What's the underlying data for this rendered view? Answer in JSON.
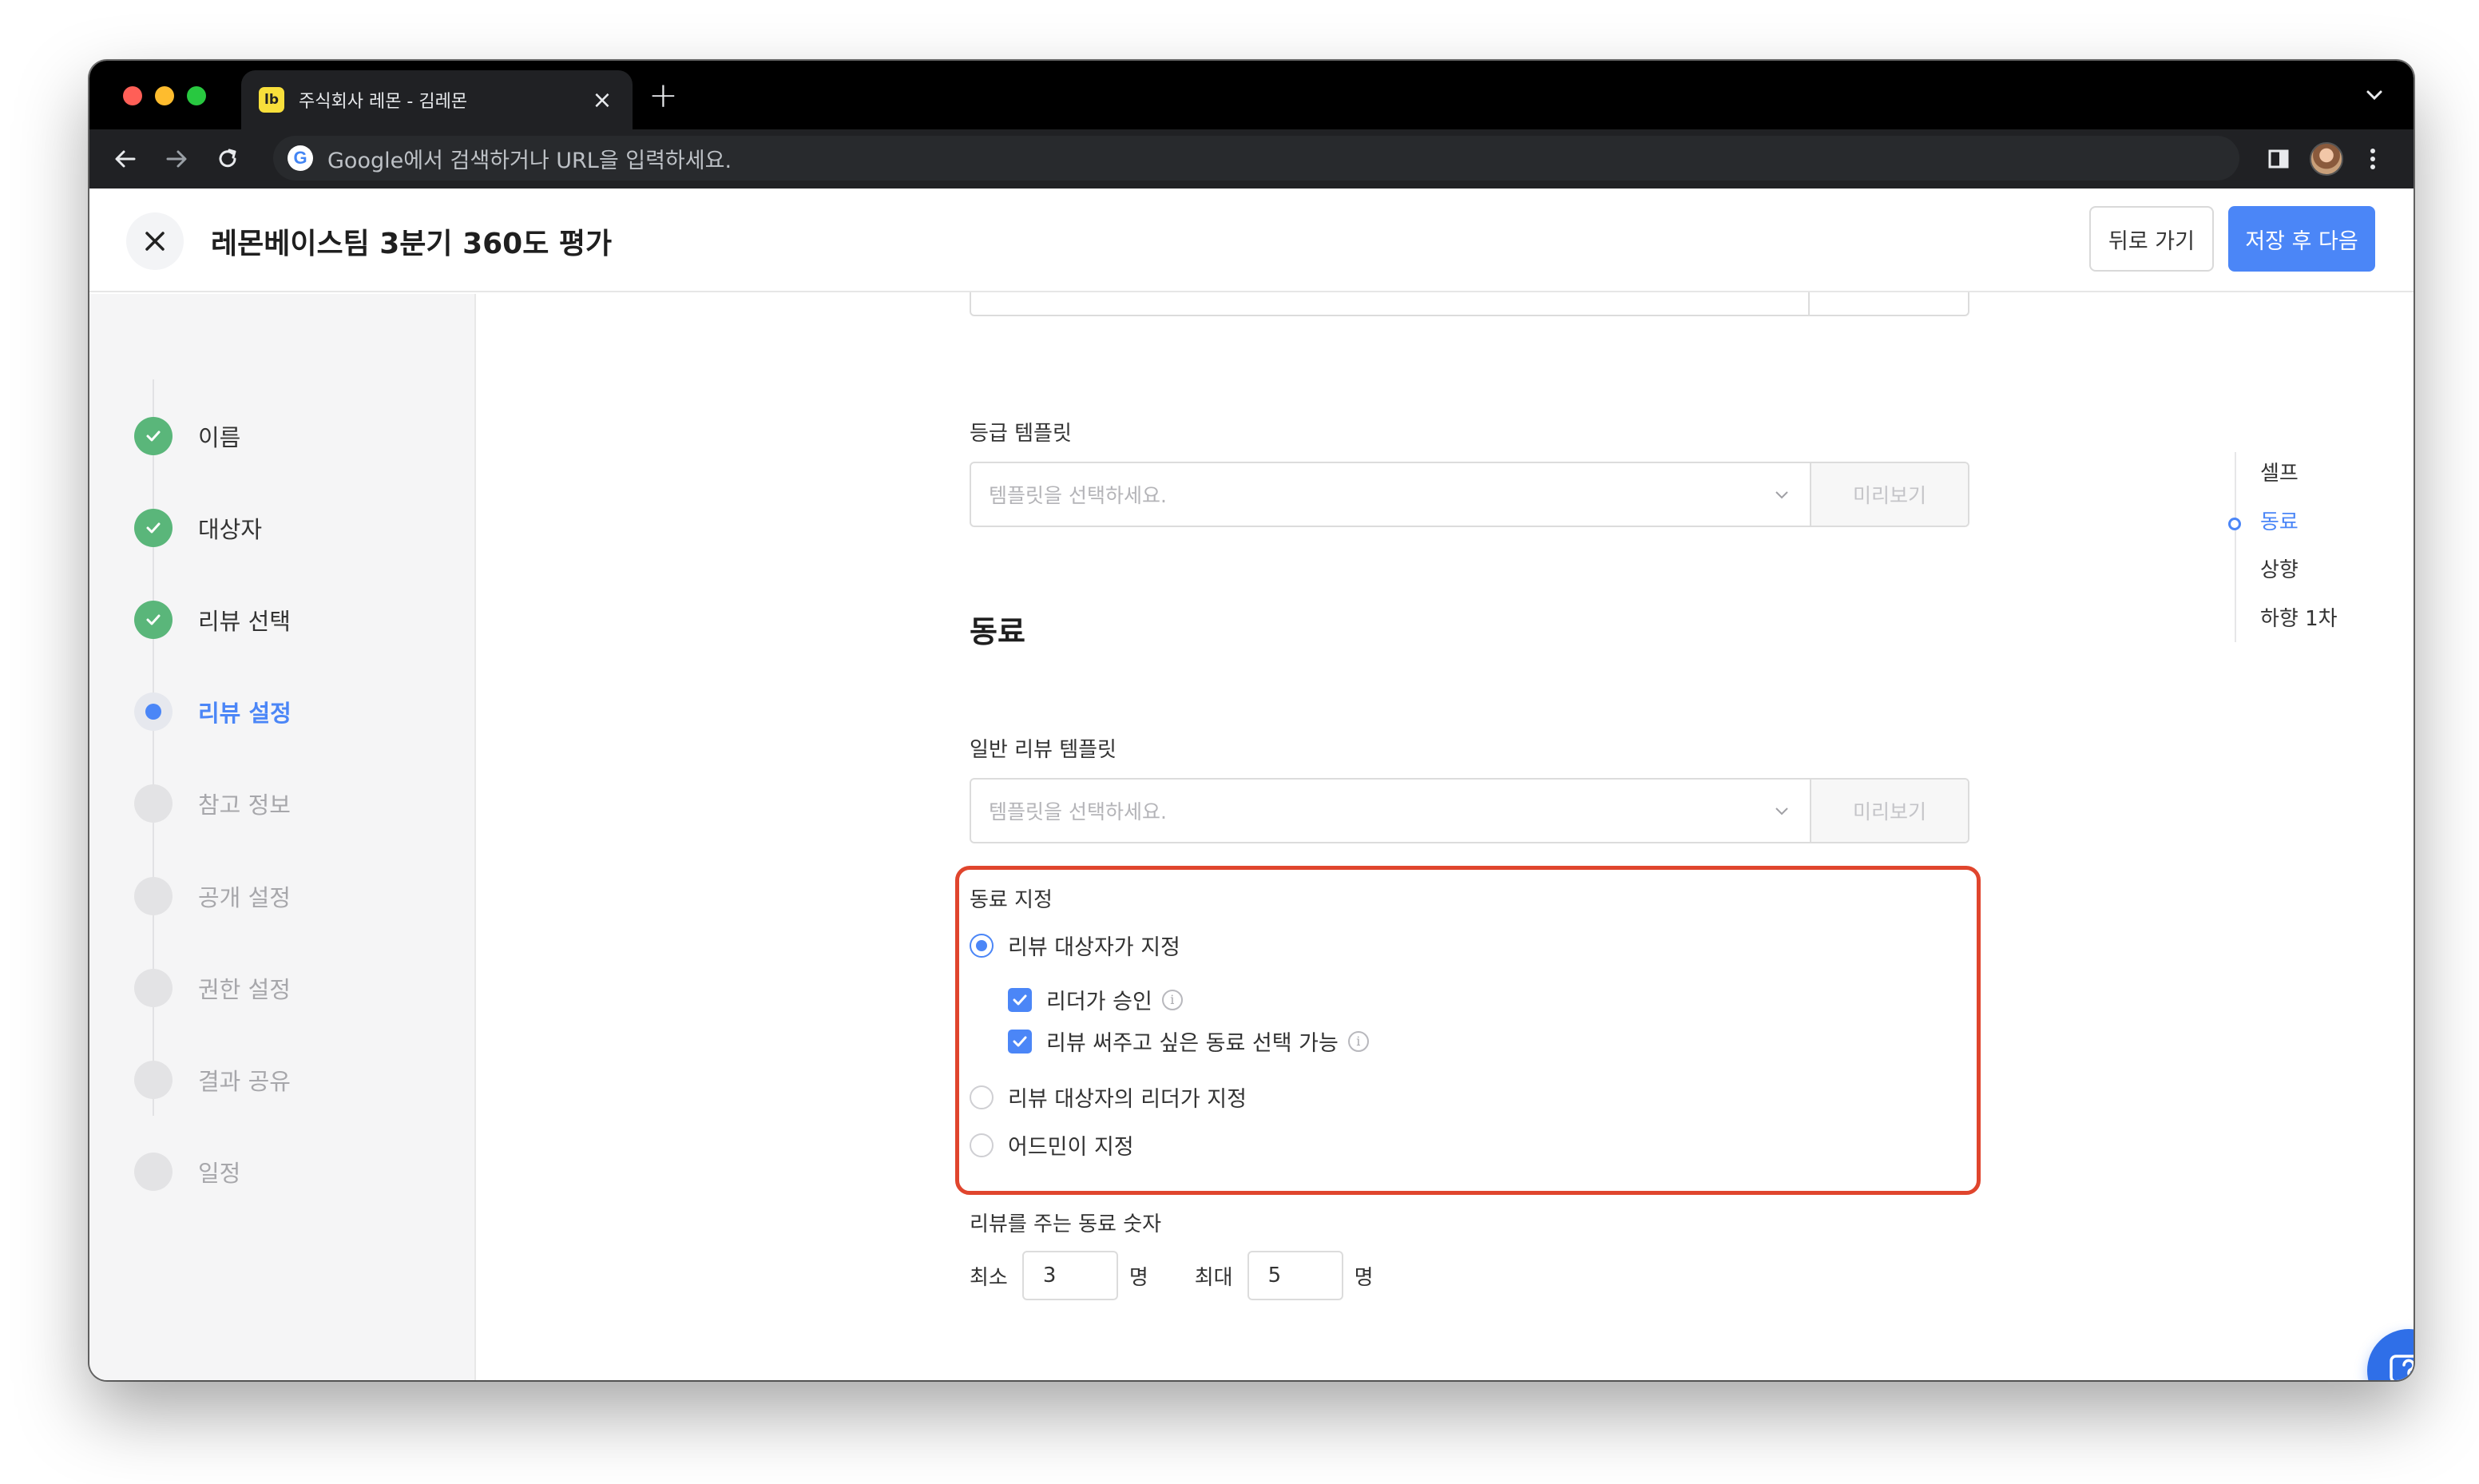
{
  "browser": {
    "tab": {
      "favicon_text": "lb",
      "title": "주식회사 레몬 - 김레몬"
    },
    "address_bar": {
      "placeholder": "Google에서 검색하거나 URL을 입력하세요."
    }
  },
  "header": {
    "title": "레몬베이스팀 3분기 360도 평가",
    "back_label": "뒤로 가기",
    "next_label": "저장 후 다음"
  },
  "sidebar": {
    "steps": [
      {
        "label": "이름",
        "state": "done"
      },
      {
        "label": "대상자",
        "state": "done"
      },
      {
        "label": "리뷰 선택",
        "state": "done"
      },
      {
        "label": "리뷰 설정",
        "state": "current"
      },
      {
        "label": "참고 정보",
        "state": "pending"
      },
      {
        "label": "공개 설정",
        "state": "pending"
      },
      {
        "label": "권한 설정",
        "state": "pending"
      },
      {
        "label": "결과 공유",
        "state": "pending"
      },
      {
        "label": "일정",
        "state": "pending"
      }
    ]
  },
  "main": {
    "grade_template": {
      "label": "등급 템플릿",
      "placeholder": "템플릿을 선택하세요.",
      "preview": "미리보기"
    },
    "peer_section": {
      "title": "동료",
      "general_template": {
        "label": "일반 리뷰 템플릿",
        "placeholder": "템플릿을 선택하세요.",
        "preview": "미리보기"
      },
      "designation": {
        "label": "동료 지정",
        "options": [
          {
            "label": "리뷰 대상자가 지정",
            "selected": true
          },
          {
            "label": "리뷰 대상자의 리더가 지정",
            "selected": false
          },
          {
            "label": "어드민이 지정",
            "selected": false
          }
        ],
        "sub_options": [
          {
            "label": "리더가 승인",
            "checked": true
          },
          {
            "label": "리뷰 써주고 싶은 동료 선택 가능",
            "checked": true
          }
        ]
      },
      "count": {
        "label": "리뷰를 주는 동료 숫자",
        "min_label": "최소",
        "min_value": "3",
        "max_label": "최대",
        "max_value": "5",
        "unit": "명"
      }
    }
  },
  "toc": {
    "items": [
      "셀프",
      "동료",
      "상향",
      "하향 1차"
    ],
    "active_index": 1
  },
  "colors": {
    "accent": "#4b86f7",
    "done_green": "#5ab67a",
    "highlight_red": "#e0452d",
    "help_button": "#2f6fe8"
  },
  "icons": [
    "close-icon",
    "check-icon",
    "chevron-down-icon",
    "info-icon",
    "question-icon",
    "back-arrow-icon",
    "forward-arrow-icon",
    "reload-icon",
    "google-icon",
    "sidebar-toggle-icon",
    "more-vert-icon"
  ]
}
